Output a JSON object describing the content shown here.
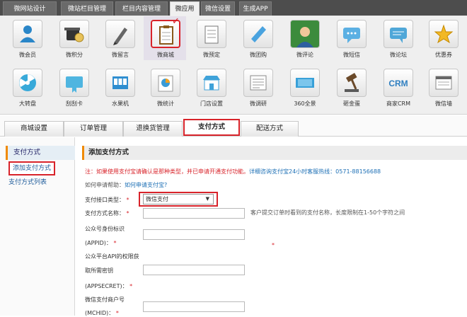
{
  "top_nav": {
    "tabs": [
      {
        "label": "微网站设计"
      },
      {
        "label": "微站栏目管理"
      },
      {
        "label": "栏目内容管理"
      },
      {
        "label": "微应用"
      },
      {
        "label": "微信设置"
      },
      {
        "label": "生成APP"
      }
    ],
    "active_index": 3
  },
  "apps": {
    "row1": [
      {
        "label": "微会员",
        "icon": "member-icon"
      },
      {
        "label": "微积分",
        "icon": "points-icon"
      },
      {
        "label": "微留言",
        "icon": "message-pen-icon"
      },
      {
        "label": "微商城",
        "icon": "clipboard-icon"
      },
      {
        "label": "微预定",
        "icon": "reservation-icon"
      },
      {
        "label": "微团购",
        "icon": "group-buy-icon"
      },
      {
        "label": "微评论",
        "icon": "comment-person-icon"
      },
      {
        "label": "微短信",
        "icon": "sms-icon"
      },
      {
        "label": "微论坛",
        "icon": "forum-icon"
      },
      {
        "label": "优惠券",
        "icon": "star-coupon-icon"
      }
    ],
    "row2": [
      {
        "label": "大转盘",
        "icon": "wheel-icon"
      },
      {
        "label": "刮刮卡",
        "icon": "scratch-card-icon"
      },
      {
        "label": "水果机",
        "icon": "slot-machine-icon"
      },
      {
        "label": "微统计",
        "icon": "pie-chart-icon"
      },
      {
        "label": "门店设置",
        "icon": "store-icon"
      },
      {
        "label": "微调研",
        "icon": "survey-icon"
      },
      {
        "label": "360全景",
        "icon": "panorama-icon"
      },
      {
        "label": "砸金蛋",
        "icon": "gold-egg-icon"
      },
      {
        "label": "商家CRM",
        "icon": "crm-icon"
      },
      {
        "label": "微信墙",
        "icon": "wechat-wall-icon"
      }
    ],
    "selected": "微商城",
    "crm_text": "CRM"
  },
  "sub_tabs": {
    "items": [
      {
        "label": "商城设置"
      },
      {
        "label": "订单管理"
      },
      {
        "label": "退换货管理"
      },
      {
        "label": "支付方式"
      },
      {
        "label": "配送方式"
      }
    ],
    "active_index": 3
  },
  "sidebar": {
    "heading": "支付方式",
    "items": [
      {
        "label": "添加支付方式",
        "active": true
      },
      {
        "label": "支付方式列表",
        "active": false
      }
    ]
  },
  "form": {
    "section_title": "添加支付方式",
    "notice_red": "注：如果使用支付宝请确认是那种类型，并已申请开通支付功能。",
    "notice_blue": "详细咨询支付宝24小时客服热线：0571-88156688",
    "help_prefix": "如何申请帮助：",
    "help_link": "如何申请支付宝?",
    "interface_type_label": "支付接口类型：",
    "interface_type_value": "微信支付",
    "name_label": "支付方式名称：",
    "name_hint": "客户提交订单时看到的支付名称，长度限制在1-50个字符之间",
    "appid_label_1": "公众号身份标识",
    "appid_label_2": "(APPID)：",
    "appsecret_label_1": "公众平台API的权限获",
    "appsecret_label_2": "取所需密钥",
    "appsecret_label_3": "(APPSECRET)：",
    "mchid_label_1": "微信支付商户号",
    "mchid_label_2": "(MCHID)：",
    "required_mark": "*"
  },
  "colors": {
    "accent_red": "#d8232a",
    "link_blue": "#1c6fb5",
    "nav_bg": "#4d4d4d",
    "side_marker": "#f08a00"
  }
}
